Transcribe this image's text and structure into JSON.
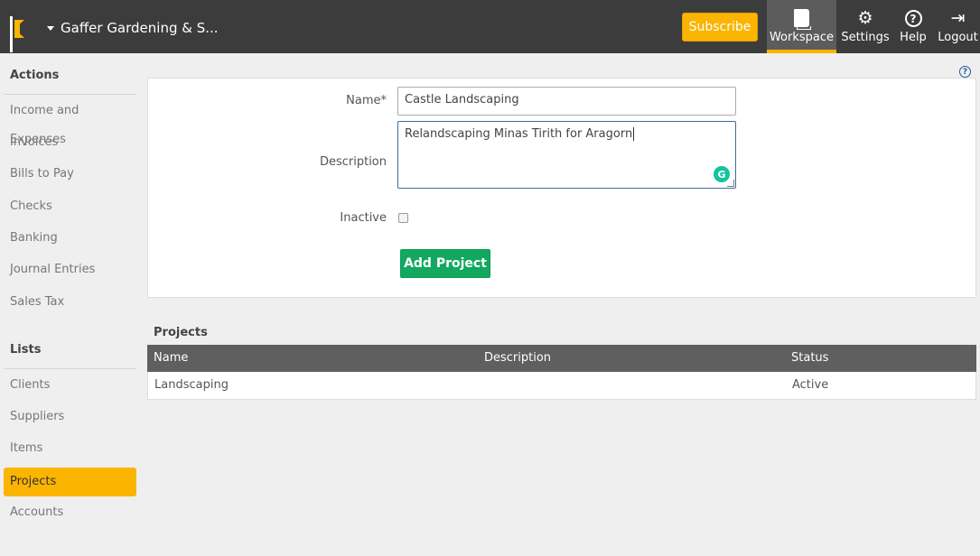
{
  "header": {
    "company_name": "Gaffer Gardening & S...",
    "subscribe_label": "Subscribe",
    "nav": {
      "workspace": "Workspace",
      "settings": "Settings",
      "help": "Help",
      "logout": "Logout"
    }
  },
  "sidebar": {
    "actions_heading": "Actions",
    "actions": [
      "Income and Expenses",
      "Invoices",
      "Bills to Pay",
      "Checks",
      "Banking",
      "Journal Entries",
      "Sales Tax"
    ],
    "lists_heading": "Lists",
    "lists": [
      "Clients",
      "Suppliers",
      "Items",
      "Projects",
      "Accounts"
    ],
    "active_item": "Projects"
  },
  "form": {
    "name_label": "Name*",
    "name_value": "Castle Landscaping",
    "description_label": "Description",
    "description_value": "Relandscaping Minas Tirith for Aragorn",
    "inactive_label": "Inactive",
    "inactive_checked": false,
    "submit_label": "Add Project"
  },
  "projects": {
    "title": "Projects",
    "columns": [
      "Name",
      "Description",
      "Status"
    ],
    "rows": [
      [
        "Landscaping",
        "",
        "Active"
      ]
    ]
  },
  "colors": {
    "topbar": "#3c3c3c",
    "accent": "#fbb400",
    "primary_button": "#12a85f",
    "table_header": "#5f5f5f"
  }
}
